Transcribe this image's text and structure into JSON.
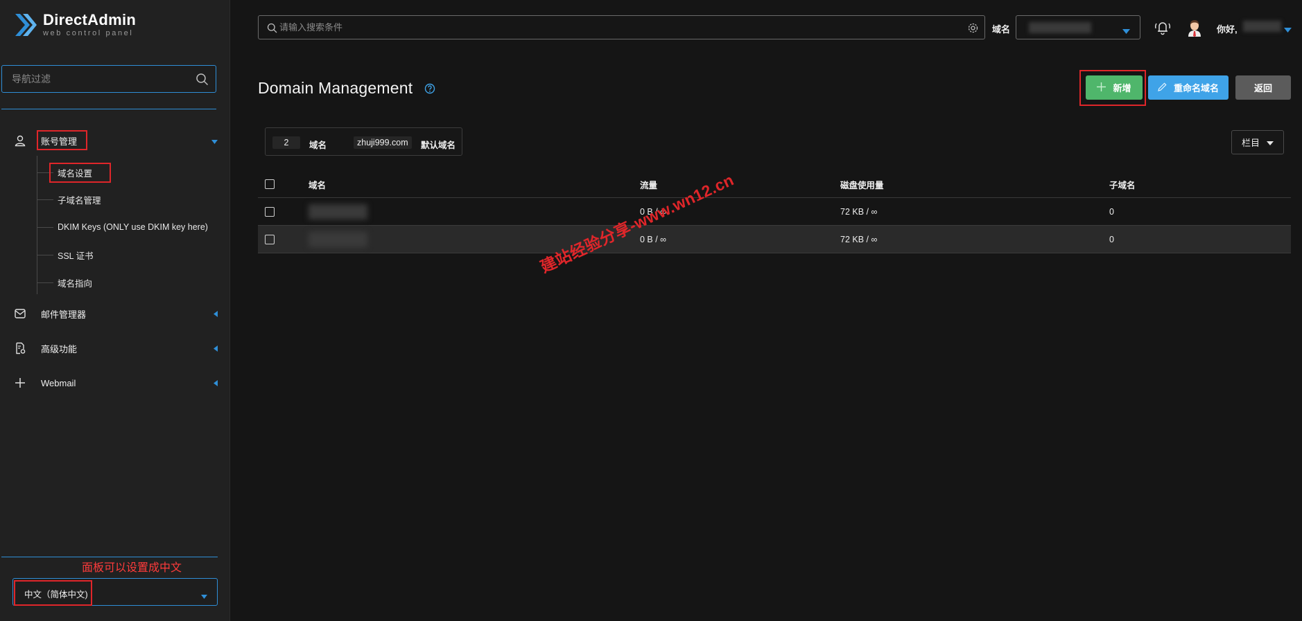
{
  "brand": {
    "title": "DirectAdmin",
    "subtitle": "web control panel"
  },
  "sidebar": {
    "filter_placeholder": "导航过滤",
    "sections": [
      {
        "label": "账号管理",
        "icon": "user-icon",
        "expanded": true
      },
      {
        "label": "邮件管理器",
        "icon": "mail-icon",
        "expanded": false
      },
      {
        "label": "高级功能",
        "icon": "advanced-settings-icon",
        "expanded": false
      },
      {
        "label": "Webmail",
        "icon": "plus-icon",
        "expanded": false
      }
    ],
    "subitems": [
      {
        "label": "域名设置"
      },
      {
        "label": "子域名管理"
      },
      {
        "label": "DKIM Keys (ONLY use DKIM key here)"
      },
      {
        "label": "SSL 证书"
      },
      {
        "label": "域名指向"
      }
    ],
    "annotation": "面板可以设置成中文",
    "language": "中文（简体中文)"
  },
  "topbar": {
    "search_placeholder": "请输入搜索条件",
    "domain_label": "域名",
    "greeting": "你好,",
    "icons": [
      "search-icon",
      "gear-icon",
      "bell-icon",
      "avatar"
    ]
  },
  "page": {
    "title": "Domain Management",
    "buttons": {
      "add": "新增",
      "rename": "重命名域名",
      "back": "返回"
    },
    "summary": {
      "count": "2",
      "count_label": "域名",
      "default_domain": "zhuji999.com",
      "default_label": "默认域名"
    },
    "columns_button": "栏目"
  },
  "table": {
    "headers": [
      "域名",
      "流量",
      "磁盘使用量",
      "子域名"
    ],
    "rows": [
      {
        "bandwidth": "0 B / ∞",
        "disk": "72 KB / ∞",
        "subdomains": "0"
      },
      {
        "bandwidth": "0 B / ∞",
        "disk": "72 KB / ∞",
        "subdomains": "0"
      }
    ]
  },
  "watermark": "建站经验分享-www.wn12.cn",
  "colors": {
    "accent": "#2f8fd8",
    "add_button": "#4fb66b",
    "rename_button": "#3fa3e8",
    "back_button": "#5b5b5b",
    "highlight_red": "#e0262a"
  }
}
